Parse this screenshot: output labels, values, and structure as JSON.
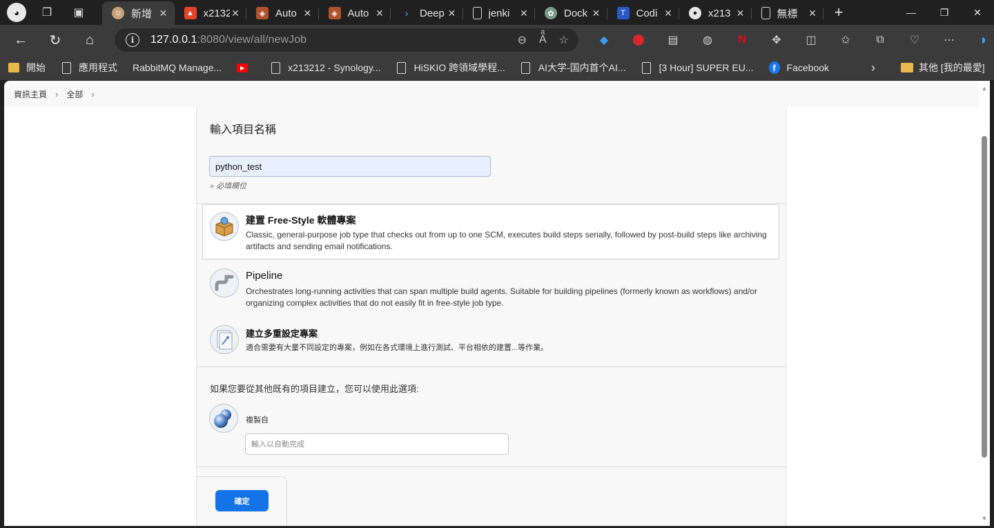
{
  "browser": {
    "tabs": [
      {
        "label": "新增",
        "icon": "avatar-favicon",
        "color": "#c8a27a",
        "active": true
      },
      {
        "label": "x2132",
        "icon": "gitlab-icon",
        "color": "#e24329"
      },
      {
        "label": "Auto",
        "icon": "shield-favicon",
        "color": "#b0522c"
      },
      {
        "label": "Auto",
        "icon": "shield-favicon",
        "color": "#b0522c"
      },
      {
        "label": "Deep",
        "icon": "terminal-favicon",
        "color": "#3b5bdb"
      },
      {
        "label": "jenki",
        "icon": "document-icon",
        "color": "#dadada"
      },
      {
        "label": "Dock",
        "icon": "openai-icon",
        "color": "#7a9b8a"
      },
      {
        "label": "Codi",
        "icon": "tc-logo-icon",
        "color": "#2b59c3"
      },
      {
        "label": "x213",
        "icon": "github-icon",
        "color": "#e6e6e6"
      },
      {
        "label": "無標",
        "icon": "document-icon",
        "color": "#dadada"
      }
    ],
    "url_host": "127.0.0.1",
    "url_path": ":8080/view/all/newJob",
    "bookmarks": [
      {
        "label": "開始",
        "icon": "folder-icon"
      },
      {
        "label": "應用程式",
        "icon": "page-icon"
      },
      {
        "label": "RabbitMQ Manage...",
        "icon": "none"
      },
      {
        "label": "",
        "icon": "youtube-icon"
      },
      {
        "label": "x213212 - Synology...",
        "icon": "page-icon"
      },
      {
        "label": "HiSKIO 跨領域學程...",
        "icon": "page-icon"
      },
      {
        "label": "AI大学-国内首个AI...",
        "icon": "page-icon"
      },
      {
        "label": "[3 Hour] SUPER EU...",
        "icon": "page-icon"
      },
      {
        "label": "Facebook",
        "icon": "facebook-icon"
      }
    ],
    "other_bookmarks": "其他 [我的最愛]"
  },
  "breadcrumb": {
    "home": "資訊主頁",
    "all": "全部"
  },
  "form": {
    "name_heading": "輸入項目名稱",
    "name_value": "python_test",
    "required_note": "» 必填欄位",
    "job_types": [
      {
        "title": "建置 Free-Style 軟體專案",
        "desc": "Classic, general-purpose job type that checks out from up to one SCM, executes build steps serially, followed by post-build steps like archiving artifacts and sending email notifications.",
        "icon": "freestyle-box-icon",
        "selected": true
      },
      {
        "title": "Pipeline",
        "desc": "Orchestrates long-running activities that can span multiple build agents. Suitable for building pipelines (formerly known as workflows) and/or organizing complex activities that do not easily fit in free-style job type.",
        "icon": "pipeline-icon",
        "selected": false
      },
      {
        "title": "建立多重設定專案",
        "desc": "適合需要有大量不同設定的專案，例如在各式環境上進行測試、平台相依的建置...等作業。",
        "icon": "multi-config-icon",
        "selected": false
      }
    ],
    "copy_intro": "如果您要從其他既有的項目建立，您可以使用此選項:",
    "copy_label": "複製自",
    "copy_placeholder": "輸入以自動完成",
    "ok_label": "確定"
  },
  "colors": {
    "accent": "#1473e6",
    "chrome_dark": "#202020",
    "chrome_toolbar": "#3b3b3b",
    "panel_bg": "#f8f8f8"
  }
}
